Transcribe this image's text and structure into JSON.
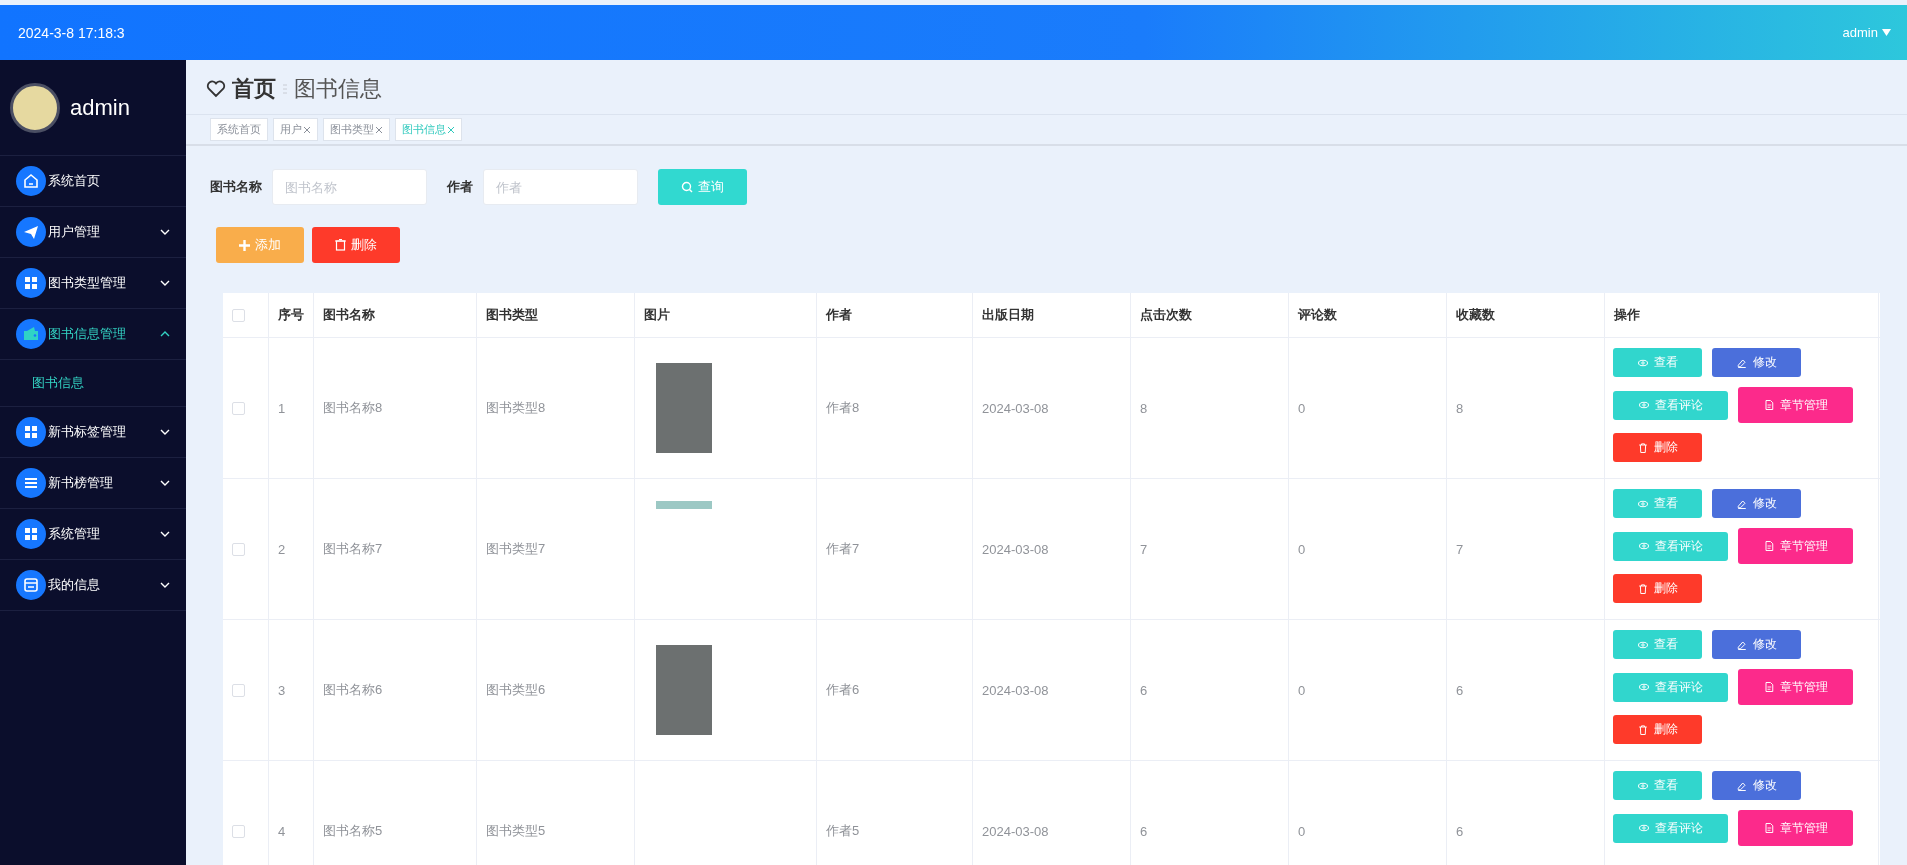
{
  "top_bar": {
    "datetime": "2024-3-8 17:18:3",
    "user": "admin"
  },
  "sidebar": {
    "profile": {
      "name": "admin"
    },
    "items": [
      {
        "label": "系统首页",
        "kind": "link",
        "selected": false
      },
      {
        "label": "用户管理",
        "kind": "group",
        "selected": false,
        "expanded": false
      },
      {
        "label": "图书类型管理",
        "kind": "group",
        "selected": false,
        "expanded": false
      },
      {
        "label": "图书信息管理",
        "kind": "group",
        "selected": true,
        "expanded": true,
        "children": [
          {
            "label": "图书信息",
            "selected": true
          }
        ]
      },
      {
        "label": "新书标签管理",
        "kind": "group",
        "selected": false,
        "expanded": false
      },
      {
        "label": "新书榜管理",
        "kind": "group",
        "selected": false,
        "expanded": false
      },
      {
        "label": "系统管理",
        "kind": "group",
        "selected": false,
        "expanded": false
      },
      {
        "label": "我的信息",
        "kind": "group",
        "selected": false,
        "expanded": false
      }
    ]
  },
  "breadcrumb": {
    "home": "首页",
    "current": "图书信息"
  },
  "tabs": [
    {
      "label": "系统首页",
      "selected": false,
      "closable": false
    },
    {
      "label": "用户",
      "selected": false,
      "closable": true
    },
    {
      "label": "图书类型",
      "selected": false,
      "closable": true
    },
    {
      "label": "图书信息",
      "selected": true,
      "closable": true
    }
  ],
  "search": {
    "fields": [
      {
        "label": "图书名称",
        "placeholder": "图书名称"
      },
      {
        "label": "作者",
        "placeholder": "作者"
      }
    ],
    "button": "查询"
  },
  "toolbar": {
    "add": "添加",
    "delete": "删除"
  },
  "table": {
    "header_checked": false,
    "columns": [
      "序号",
      "图书名称",
      "图书类型",
      "图片",
      "作者",
      "出版日期",
      "点击次数",
      "评论数",
      "收藏数",
      "操作"
    ],
    "rows": [
      {
        "checked": false,
        "cells": [
          "1",
          "图书名称8",
          "图书类型8",
          "",
          "作者8",
          "2024-03-08",
          "8",
          "0",
          "8"
        ],
        "picture": {
          "kind": "cover"
        },
        "actions": [
          {
            "label": "查看",
            "kind": "view"
          },
          {
            "label": "修改",
            "kind": "edit"
          },
          {
            "label": "查看评论",
            "kind": "comments"
          },
          {
            "label": "章节管理",
            "kind": "chapters"
          },
          {
            "label": "删除",
            "kind": "delete"
          }
        ]
      },
      {
        "checked": false,
        "cells": [
          "2",
          "图书名称7",
          "图书类型7",
          "",
          "作者7",
          "2024-03-08",
          "7",
          "0",
          "7"
        ],
        "picture": {
          "kind": "partial"
        },
        "actions": [
          {
            "label": "查看",
            "kind": "view"
          },
          {
            "label": "修改",
            "kind": "edit"
          },
          {
            "label": "查看评论",
            "kind": "comments"
          },
          {
            "label": "章节管理",
            "kind": "chapters"
          },
          {
            "label": "删除",
            "kind": "delete"
          }
        ]
      },
      {
        "checked": false,
        "cells": [
          "3",
          "图书名称6",
          "图书类型6",
          "",
          "作者6",
          "2024-03-08",
          "6",
          "0",
          "6"
        ],
        "picture": {
          "kind": "cover"
        },
        "actions": [
          {
            "label": "查看",
            "kind": "view"
          },
          {
            "label": "修改",
            "kind": "edit"
          },
          {
            "label": "查看评论",
            "kind": "comments"
          },
          {
            "label": "章节管理",
            "kind": "chapters"
          },
          {
            "label": "删除",
            "kind": "delete"
          }
        ]
      },
      {
        "checked": false,
        "cells": [
          "4",
          "图书名称5",
          "图书类型5",
          "",
          "作者5",
          "2024-03-08",
          "6",
          "0",
          "6"
        ],
        "actions": [
          {
            "label": "查看",
            "kind": "view"
          },
          {
            "label": "修改",
            "kind": "edit"
          },
          {
            "label": "查看评论",
            "kind": "comments"
          },
          {
            "label": "章节管理",
            "kind": "chapters"
          }
        ]
      }
    ]
  }
}
